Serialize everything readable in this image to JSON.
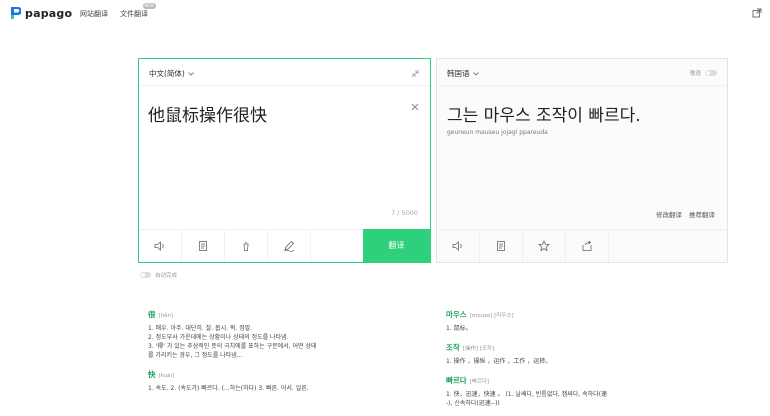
{
  "header": {
    "logo_text": "papago",
    "nav": [
      {
        "label": "网站翻译"
      },
      {
        "label": "文件翻译",
        "badge": "NEW"
      }
    ]
  },
  "source": {
    "language": "中文(简体)",
    "text": "他鼠标操作很快",
    "count": "7 / 5000",
    "translate_label": "翻译"
  },
  "target": {
    "language": "韩国语",
    "honorific_label": "敬语",
    "text": "그는 마우스 조작이 빠르다.",
    "romanization": "geuneun mauseu jojagi ppareuda",
    "links": [
      "修改翻译",
      "推荐翻译"
    ]
  },
  "auto_detect_label": "自动完成",
  "dictionary": {
    "left": [
      {
        "word": "很",
        "phonetic": "[hěn]",
        "lines": [
          "1. 매우. 아주. 대단히. 잘. 몹시. 퍽. 정말.",
          "2. 정도부사 가운데에는 상황이나 상태의 정도를 나타냄.",
          "3. '得' 가 있는 추상적인 뜻의 극치에를 표하는 구문에서, 어떤 상태",
          "   를 가리키는 경우, 그 정도를 나타냄..."
        ]
      },
      {
        "word": "快",
        "phonetic": "[kuài]",
        "lines": [
          "1. 속도.   2. (속도가) 빠르다. (...하는(하다)   3. 빠른. 어서. 얼른."
        ]
      }
    ],
    "right": [
      {
        "word": "마우스",
        "phonetic": "[mouse] [마우스]",
        "lines": [
          "1. 鼠标。"
        ]
      },
      {
        "word": "조작",
        "phonetic": "[操作] [조작]",
        "lines": [
          "1. 操作 ，操纵 ，运作 ，工作 ，运转。"
        ]
      },
      {
        "word": "빠르다",
        "phonetic": "[빠르다]",
        "lines": [
          "1. 快，迅速，快速 。 (1. 날쌔다, 빈틈없다, 잽싸다, 속하다(速",
          "   -), 신속하다(迅速--))"
        ]
      }
    ]
  }
}
